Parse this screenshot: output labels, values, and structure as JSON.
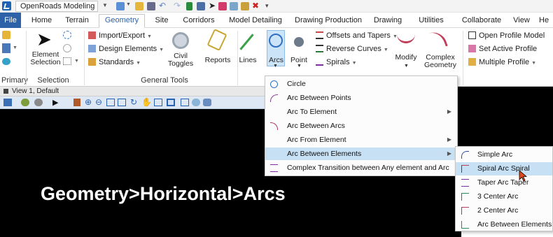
{
  "qat": {
    "workflow": "OpenRoads Modeling"
  },
  "tabs": [
    "File",
    "Home",
    "Terrain",
    "Geometry",
    "Site",
    "Corridors",
    "Model Detailing",
    "Drawing Production",
    "Drawing",
    "Utilities",
    "Collaborate",
    "View",
    "He"
  ],
  "ribbon": {
    "primary_label": "Primary",
    "selection": {
      "label": "Selection",
      "element_selection": "Element Selection"
    },
    "general_tools": {
      "label": "General Tools",
      "import_export": "Import/Export",
      "design_elements": "Design Elements",
      "standards": "Standards",
      "civil_toggles": "Civil Toggles",
      "reports": "Reports"
    },
    "horizontal": {
      "lines": "Lines",
      "arcs": "Arcs",
      "point": "Point",
      "offsets_tapers": "Offsets and Tapers",
      "reverse_curves": "Reverse Curves",
      "spirals": "Spirals",
      "modify": "Modify",
      "complex_geometry": "Complex Geometry"
    },
    "vertical": {
      "open_profile_model": "Open Profile Model",
      "set_active_profile": "Set Active Profile",
      "multiple_profile": "Multiple Profile"
    }
  },
  "view": {
    "title": "View 1, Default"
  },
  "caption": "Geometry>Horizontal>Arcs",
  "arcs_menu": [
    {
      "label": "Circle",
      "icon": "circle-icon",
      "submenu": false
    },
    {
      "label": "Arc Between Points",
      "icon": "arc-points-icon",
      "submenu": false
    },
    {
      "label": "Arc To Element",
      "icon": "",
      "submenu": true
    },
    {
      "label": "Arc Between Arcs",
      "icon": "arc-arcs-icon",
      "submenu": false
    },
    {
      "label": "Arc From Element",
      "icon": "",
      "submenu": true
    },
    {
      "label": "Arc Between Elements",
      "icon": "",
      "submenu": true
    },
    {
      "label": "Complex Transition between Any element and Arc",
      "icon": "complex-transition-icon",
      "submenu": false
    }
  ],
  "sub_menu": [
    {
      "label": "Simple Arc",
      "icon": "simple-arc-icon"
    },
    {
      "label": "Spiral Arc Spiral",
      "icon": "spiral-arc-spiral-icon"
    },
    {
      "label": "Taper Arc Taper",
      "icon": "taper-arc-taper-icon"
    },
    {
      "label": "3 Center Arc",
      "icon": "three-center-arc-icon"
    },
    {
      "label": "2 Center Arc",
      "icon": "two-center-arc-icon"
    },
    {
      "label": "Arc Between Elements",
      "icon": "arc-between-elements-icon"
    }
  ],
  "colors": {
    "file_tab": "#2d62a9",
    "highlight": "#c7e0f4",
    "canvas": "#000000",
    "caption": "#ffffff"
  }
}
